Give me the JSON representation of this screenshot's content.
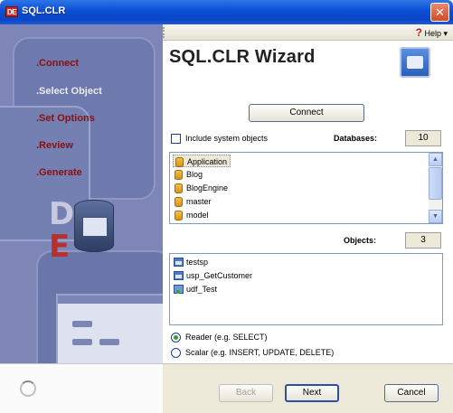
{
  "window": {
    "icon_text": "DE",
    "title": "SQL.CLR",
    "close_symbol": "✕"
  },
  "sidebar": {
    "steps": [
      {
        "label": ".Connect",
        "state": "done"
      },
      {
        "label": ".Select Object",
        "state": "current"
      },
      {
        "label": ".Set Options",
        "state": "pending"
      },
      {
        "label": ".Review",
        "state": "pending"
      },
      {
        "label": ".Generate",
        "state": "pending"
      }
    ],
    "logo_letters": [
      "D",
      "E"
    ]
  },
  "toolbar": {
    "help_icon": "?",
    "help_label": "Help ▾"
  },
  "main": {
    "title": "SQL.CLR Wizard",
    "connect_label": "Connect",
    "include_system_label": "Include system objects",
    "include_system_checked": false,
    "databases_label": "Databases:",
    "databases_count": "10",
    "databases": [
      {
        "name": "Application",
        "selected": true
      },
      {
        "name": "Blog",
        "selected": false
      },
      {
        "name": "BlogEngine",
        "selected": false
      },
      {
        "name": "master",
        "selected": false
      },
      {
        "name": "model",
        "selected": false
      }
    ],
    "objects_label": "Objects:",
    "objects_count": "3",
    "objects": [
      {
        "name": "testsp",
        "icon": "procedure-icon"
      },
      {
        "name": "usp_GetCustomer",
        "icon": "procedure-icon"
      },
      {
        "name": "udf_Test",
        "icon": "function-icon"
      }
    ],
    "radio_options": [
      {
        "label": "Reader (e.g. SELECT)",
        "checked": true
      },
      {
        "label": "Scalar (e.g. INSERT, UPDATE, DELETE)",
        "checked": false
      }
    ]
  },
  "buttons": {
    "back": "Back",
    "next": "Next",
    "cancel": "Cancel"
  }
}
